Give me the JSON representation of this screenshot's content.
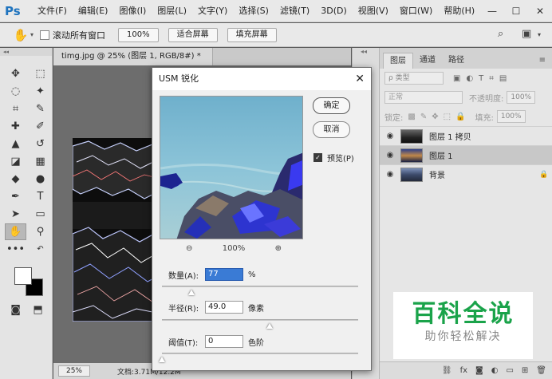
{
  "app": {
    "logo": "Ps",
    "menu": [
      "文件(F)",
      "编辑(E)",
      "图像(I)",
      "图层(L)",
      "文字(Y)",
      "选择(S)",
      "滤镜(T)",
      "3D(D)",
      "视图(V)",
      "窗口(W)",
      "帮助(H)"
    ],
    "window_controls": [
      "—",
      "☐",
      "✕"
    ]
  },
  "options_bar": {
    "scroll_all_label": "滚动所有窗口",
    "zoom_value": "100%",
    "fit_screen_label": "适合屏幕",
    "fill_screen_label": "填充屏幕"
  },
  "document": {
    "tab_title": "timg.jpg @ 25% (图层 1, RGB/8#) *",
    "status_zoom": "25%",
    "status_doc": "文档:3.71M/12.2M"
  },
  "layers_panel": {
    "tabs": [
      "图层",
      "通道",
      "路径"
    ],
    "kind_label": "ρ 类型",
    "blend_mode": "正常",
    "opacity_label": "不透明度:",
    "opacity_value": "100%",
    "lock_label": "锁定:",
    "fill_label": "填充:",
    "fill_value": "100%",
    "layers": [
      {
        "name": "图层 1 拷贝",
        "selected": false,
        "locked": false
      },
      {
        "name": "图层 1",
        "selected": true,
        "locked": false
      },
      {
        "name": "背景",
        "selected": false,
        "locked": true
      }
    ]
  },
  "watermark": {
    "line1": "百科全说",
    "line2": "助你轻松解决"
  },
  "usm_dialog": {
    "title": "USM 锐化",
    "ok_label": "确定",
    "cancel_label": "取消",
    "preview_label": "预览(P)",
    "preview_checked": true,
    "zoom_out_icon": "⊖",
    "zoom_level": "100%",
    "zoom_in_icon": "⊕",
    "amount_label": "数量(A):",
    "amount_value": "77",
    "amount_unit": "%",
    "amount_fraction": 0.15,
    "radius_label": "半径(R):",
    "radius_value": "49.0",
    "radius_unit": "像素",
    "radius_fraction": 0.55,
    "threshold_label": "阈值(T):",
    "threshold_value": "0",
    "threshold_unit": "色阶",
    "threshold_fraction": 0.0
  }
}
